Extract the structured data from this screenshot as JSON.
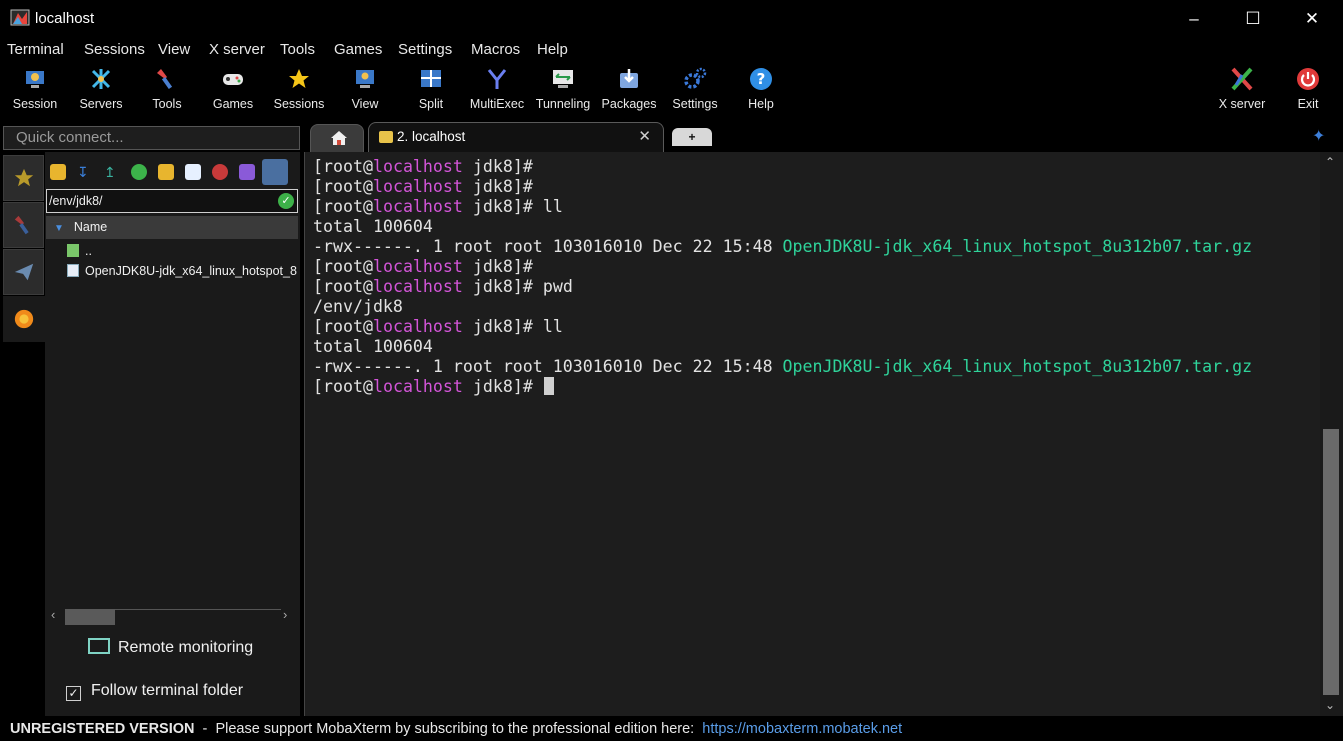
{
  "window": {
    "title": "localhost",
    "minimize_icon": "minimize-icon",
    "maximize_icon": "maximize-icon",
    "close_icon": "close-icon"
  },
  "menu": [
    "Terminal",
    "Sessions",
    "View",
    "X server",
    "Tools",
    "Games",
    "Settings",
    "Macros",
    "Help"
  ],
  "toolbar": {
    "items": [
      {
        "label": "Session",
        "icon": "session-icon"
      },
      {
        "label": "Servers",
        "icon": "servers-icon"
      },
      {
        "label": "Tools",
        "icon": "tools-icon"
      },
      {
        "label": "Games",
        "icon": "games-icon"
      },
      {
        "label": "Sessions",
        "icon": "star-icon"
      },
      {
        "label": "View",
        "icon": "view-icon"
      },
      {
        "label": "Split",
        "icon": "split-icon"
      },
      {
        "label": "MultiExec",
        "icon": "multiexec-icon"
      },
      {
        "label": "Tunneling",
        "icon": "tunneling-icon"
      },
      {
        "label": "Packages",
        "icon": "packages-icon"
      },
      {
        "label": "Settings",
        "icon": "settings-icon"
      },
      {
        "label": "Help",
        "icon": "help-icon"
      }
    ],
    "right": [
      {
        "label": "X server",
        "icon": "x-server-icon"
      },
      {
        "label": "Exit",
        "icon": "exit-icon"
      }
    ]
  },
  "quick_connect": {
    "placeholder": "Quick connect..."
  },
  "tabs": {
    "home_icon": "home-icon",
    "active_label": "2. localhost",
    "new_tab_label": "+"
  },
  "sftp": {
    "path": "/env/jdk8/",
    "column_name": "Name",
    "files": [
      {
        "name": "..",
        "icon": "parent-folder-icon"
      },
      {
        "name": "OpenJDK8U-jdk_x64_linux_hotspot_8",
        "icon": "archive-file-icon"
      }
    ],
    "remote_monitoring": "Remote monitoring",
    "follow_terminal_folder": "Follow terminal folder",
    "follow_checked": true
  },
  "terminal": {
    "prompt_user": "root",
    "prompt_host": "localhost",
    "prompt_dir": "jdk8",
    "lines": [
      {
        "kind": "prompt",
        "cmd": ""
      },
      {
        "kind": "prompt",
        "cmd": ""
      },
      {
        "kind": "prompt",
        "cmd": " ll"
      },
      {
        "kind": "text",
        "text": "total 100604"
      },
      {
        "kind": "file",
        "text": "-rwx------. 1 root root 103016010 Dec 22 15:48 ",
        "file": "OpenJDK8U-jdk_x64_linux_hotspot_8u312b07.tar.gz"
      },
      {
        "kind": "prompt",
        "cmd": ""
      },
      {
        "kind": "prompt",
        "cmd": " pwd"
      },
      {
        "kind": "text",
        "text": "/env/jdk8"
      },
      {
        "kind": "prompt",
        "cmd": " ll"
      },
      {
        "kind": "text",
        "text": "total 100604"
      },
      {
        "kind": "file",
        "text": "-rwx------. 1 root root 103016010 Dec 22 15:48 ",
        "file": "OpenJDK8U-jdk_x64_linux_hotspot_8u312b07.tar.gz"
      },
      {
        "kind": "prompt",
        "cmd": " ",
        "cursor": true
      }
    ]
  },
  "status": {
    "unregistered": "UNREGISTERED VERSION",
    "message": "  -  Please support MobaXterm by subscribing to the professional edition here:  ",
    "link": "https://mobaxterm.mobatek.net"
  },
  "colors": {
    "host": "#d355d8",
    "file": "#2fd39a",
    "link": "#5a9de8",
    "terminal_bg": "#1d1d1d"
  }
}
